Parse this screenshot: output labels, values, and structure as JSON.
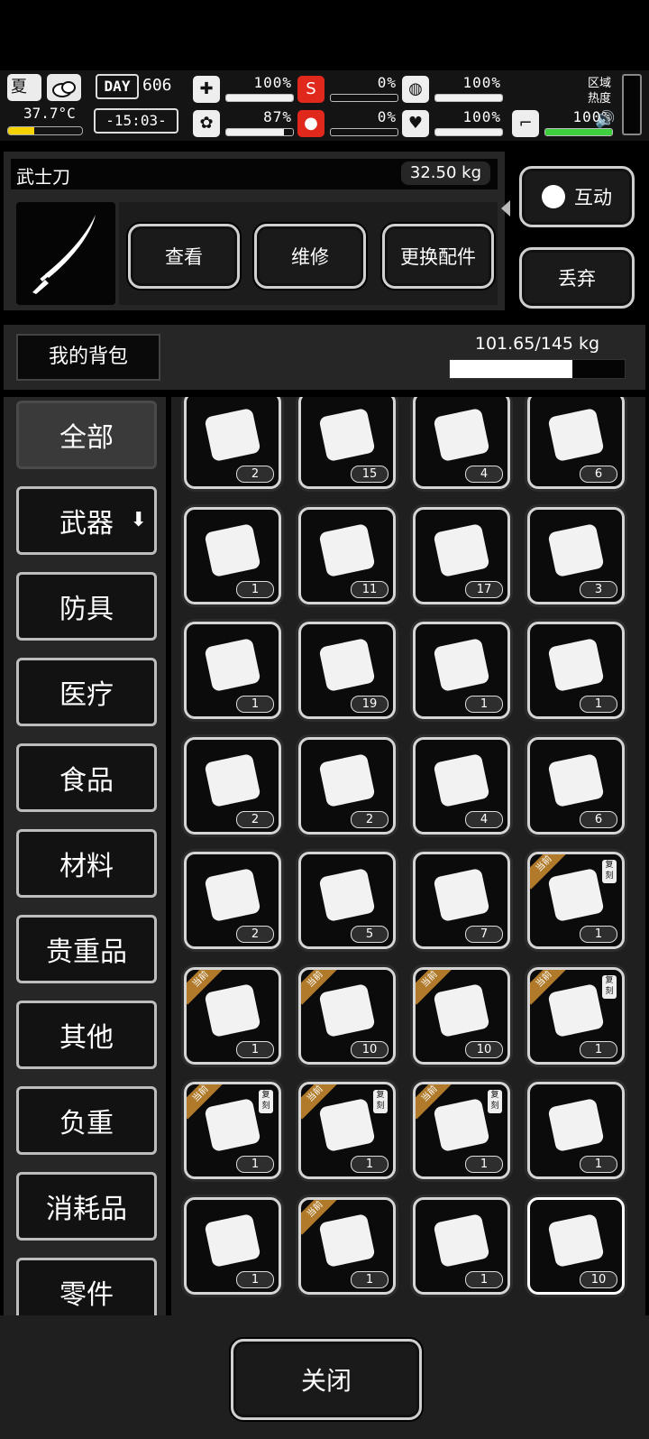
{
  "status": {
    "season": "夏",
    "temperature": "37.7°C",
    "day_label": "DAY",
    "day_number": "606",
    "clock": "-15:03-",
    "region_heat_label": "区域热度",
    "stats": [
      {
        "id": "health",
        "icon": "medkit-icon",
        "value": "100%",
        "level": 1.0
      },
      {
        "id": "hunger",
        "icon": "stomach-icon",
        "value": "0%",
        "level": 0.0
      },
      {
        "id": "protection",
        "icon": "helmet-icon",
        "value": "100%",
        "level": 1.0
      },
      {
        "id": "sanity",
        "icon": "brain-icon",
        "value": "87%",
        "level": 0.87
      },
      {
        "id": "thirst",
        "icon": "water-drop-icon",
        "value": "0%",
        "level": 0.0
      },
      {
        "id": "mood",
        "icon": "heart-icon",
        "value": "100%",
        "level": 1.0
      },
      {
        "id": "stamina",
        "icon": "boot-icon",
        "value": "100%",
        "level": 1.0
      }
    ]
  },
  "selected": {
    "name": "武士刀",
    "weight": "32.50 kg",
    "icon": "katana-icon",
    "actions": {
      "view": "查看",
      "repair": "维修",
      "swap_parts": "更换配件"
    },
    "interact": "互动",
    "discard": "丢弃"
  },
  "backpack": {
    "label": "我的背包",
    "capacity": "101.65/145 kg",
    "fill": 0.701
  },
  "categories": [
    "全部",
    "武器",
    "防具",
    "医疗",
    "食品",
    "材料",
    "贵重品",
    "其他",
    "负重",
    "消耗品",
    "零件"
  ],
  "badges": {
    "equipped": "当前",
    "copy": "复刻"
  },
  "items": [
    {
      "icon": "sponge-icon",
      "qty": "2"
    },
    {
      "icon": "spray-bottle-icon",
      "qty": "15"
    },
    {
      "icon": "plastic-bottle-icon",
      "qty": "4"
    },
    {
      "icon": "whetstone-icon",
      "qty": "6"
    },
    {
      "icon": "bandage-roll-icon",
      "qty": "1"
    },
    {
      "icon": "spring-icon",
      "qty": "11"
    },
    {
      "icon": "syringe-icon",
      "qty": "17"
    },
    {
      "icon": "screws-icon",
      "qty": "3"
    },
    {
      "icon": "liquor-bottle-icon",
      "qty": "1"
    },
    {
      "icon": "cash-stack-icon",
      "qty": "19"
    },
    {
      "icon": "bucket-icon",
      "qty": "1"
    },
    {
      "icon": "scrap-metal-icon",
      "qty": "1"
    },
    {
      "icon": "soil-sprout-icon",
      "qty": "2"
    },
    {
      "icon": "flour-sack-icon",
      "qty": "2"
    },
    {
      "icon": "logs-icon",
      "qty": "4"
    },
    {
      "icon": "crushed-bottle-icon",
      "qty": "6"
    },
    {
      "icon": "test-tube-icon",
      "qty": "2"
    },
    {
      "icon": "cotton-balls-icon",
      "qty": "5"
    },
    {
      "icon": "wood-planks-icon",
      "qty": "7"
    },
    {
      "icon": "duffel-bag-icon",
      "qty": "1",
      "equipped": true,
      "copy": true
    },
    {
      "icon": "tactical-vest-icon",
      "qty": "1",
      "equipped": true
    },
    {
      "icon": "net-trap-icon",
      "qty": "10",
      "equipped": true
    },
    {
      "icon": "net-trap-icon",
      "qty": "10",
      "equipped": true
    },
    {
      "icon": "whip-icon",
      "qty": "1",
      "equipped": true,
      "copy": true
    },
    {
      "icon": "gloves-icon",
      "qty": "1",
      "equipped": true,
      "copy": true
    },
    {
      "icon": "jacket-icon",
      "qty": "1",
      "equipped": true,
      "copy": true
    },
    {
      "icon": "cap-icon",
      "qty": "1",
      "equipped": true,
      "copy": true
    },
    {
      "icon": "revolver-icon",
      "qty": "1"
    },
    {
      "icon": "knife-icon",
      "qty": "1"
    },
    {
      "icon": "bow-icon",
      "qty": "1",
      "equipped": true
    },
    {
      "icon": "flask-icon",
      "qty": "1"
    },
    {
      "icon": "katana-icon",
      "qty": "10",
      "selected": true
    }
  ],
  "close_label": "关闭"
}
